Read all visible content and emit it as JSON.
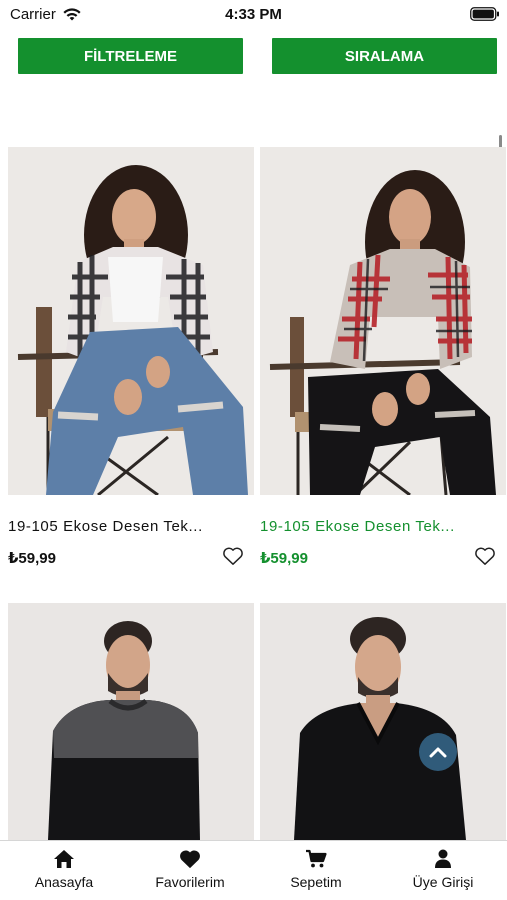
{
  "status_bar": {
    "carrier": "Carrier",
    "time": "4:33 PM"
  },
  "toolbar": {
    "filter_label": "FİLTRELEME",
    "sort_label": "SIRALAMA",
    "accent_color": "#14902e"
  },
  "products": [
    {
      "name": "19-105 Ekose Desen Tek...",
      "price": "₺59,99",
      "highlighted": false,
      "image": "woman-white-black-plaid-shirt-jeans"
    },
    {
      "name": "19-105 Ekose Desen Tek...",
      "price": "₺59,99",
      "highlighted": true,
      "image": "woman-red-plaid-shirt-black-jeans"
    },
    {
      "name": "",
      "price": "",
      "highlighted": false,
      "image": "man-grey-black-sweater"
    },
    {
      "name": "",
      "price": "",
      "highlighted": false,
      "image": "man-black-vneck-sweater"
    }
  ],
  "tabs": [
    {
      "label": "Anasayfa",
      "icon": "home-icon"
    },
    {
      "label": "Favorilerim",
      "icon": "heart-icon"
    },
    {
      "label": "Sepetim",
      "icon": "cart-icon"
    },
    {
      "label": "Üye Girişi",
      "icon": "user-icon"
    }
  ]
}
